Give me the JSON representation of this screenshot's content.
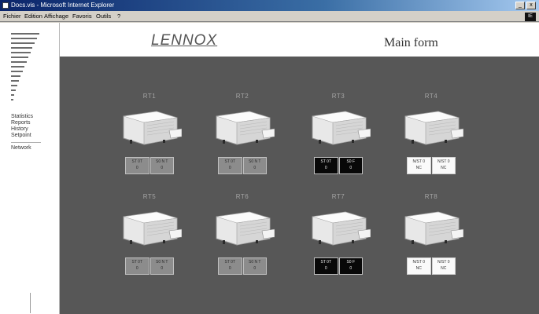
{
  "window": {
    "title": "Docs.vis - Microsoft Internet Explorer",
    "buttons": [
      "_",
      "x"
    ]
  },
  "menubar": {
    "items": [
      "Fichier",
      "Edition",
      "Affichage",
      "Favoris",
      "Outils",
      "?"
    ],
    "right_box": "IE"
  },
  "sidebar": {
    "nav_items": [
      "Statistics",
      "Reports",
      "History",
      "Setpoint"
    ],
    "nav_items_bottom": [
      "Network"
    ]
  },
  "header": {
    "logo": "LENNOX",
    "page_title": "Main form"
  },
  "units": [
    {
      "label": "RT1",
      "status_style": "gray",
      "cells": [
        [
          "ST 0T",
          "0"
        ],
        [
          "S0 N T",
          "0"
        ]
      ]
    },
    {
      "label": "RT2",
      "status_style": "gray",
      "cells": [
        [
          "ST 0T",
          "0"
        ],
        [
          "S0 N T",
          "0"
        ]
      ]
    },
    {
      "label": "RT3",
      "status_style": "black",
      "cells": [
        [
          "ST 0T",
          "0"
        ],
        [
          "S0 F",
          "0"
        ]
      ]
    },
    {
      "label": "RT4",
      "status_style": "white",
      "cells": [
        [
          "N/ST 0",
          "NC"
        ],
        [
          "N/ST 0",
          "NC"
        ]
      ]
    },
    {
      "label": "RT5",
      "status_style": "gray",
      "cells": [
        [
          "ST 0T",
          "0"
        ],
        [
          "S0 N T",
          "0"
        ]
      ]
    },
    {
      "label": "RT6",
      "status_style": "gray",
      "cells": [
        [
          "ST 0T",
          "0"
        ],
        [
          "S0 N T",
          "0"
        ]
      ]
    },
    {
      "label": "RT7",
      "status_style": "black",
      "cells": [
        [
          "ST 0T",
          "0"
        ],
        [
          "S0 F",
          "0"
        ]
      ]
    },
    {
      "label": "RT8",
      "status_style": "white",
      "cells": [
        [
          "N/ST 0",
          "NC"
        ],
        [
          "N/ST 0",
          "NC"
        ]
      ]
    }
  ],
  "colors": {
    "main_bg": "#575757",
    "status_gray": "#8c8c8c",
    "status_black": "#080808",
    "status_white": "#fafafa"
  },
  "icons": {
    "unit": "rooftop-ac-unit-icon",
    "level_bars": "level-bars-icon"
  }
}
